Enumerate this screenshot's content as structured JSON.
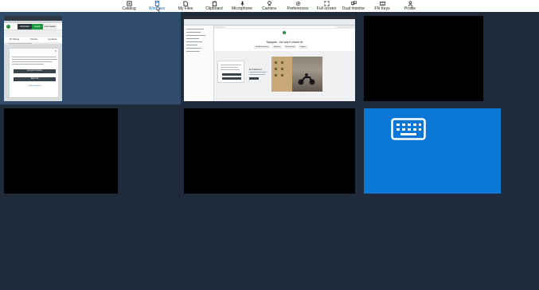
{
  "toolbar": {
    "items": [
      {
        "label": "Catalog",
        "icon": "catalog-icon"
      },
      {
        "label": "Windows",
        "icon": "windows-icon",
        "active": true
      },
      {
        "label": "My Files",
        "icon": "folder-icon"
      },
      {
        "label": "Clipboard",
        "icon": "clipboard-icon"
      },
      {
        "label": "Microphone",
        "icon": "microphone-icon"
      },
      {
        "label": "Camera",
        "icon": "camera-icon"
      },
      {
        "label": "Preferences",
        "icon": "gear-icon"
      },
      {
        "label": "Full screen",
        "icon": "fullscreen-icon"
      },
      {
        "label": "Dual monitor",
        "icon": "dual-monitor-icon"
      },
      {
        "label": "FN Keys",
        "icon": "keyboard-icon"
      },
      {
        "label": "Profile",
        "icon": "person-icon"
      }
    ]
  },
  "colors": {
    "background": "#1f2b3a",
    "selected_frame": "#2f4d6b",
    "accent": "#1a6fc4",
    "keyboard_tile": "#0a77d6"
  },
  "windows": {
    "thumb1": {
      "header_buttons": [
        "Download",
        "Search",
        "Find a Dealer"
      ],
      "subnav": [
        "3D Training",
        "Tutorials",
        "Feedback"
      ],
      "dialog_buttons": [
        "Accept All Cookies",
        "Reject All"
      ],
      "dialog_link": "Cookies Settings"
    },
    "thumb2": {
      "site_title": "Navigate – the way it should be",
      "nav_items": [
        "Get More Features",
        "Solutions",
        "Find a Dealer",
        "Support"
      ],
      "product_heading": "E-Transport"
    },
    "thumb6": {
      "icon": "keyboard-icon"
    }
  }
}
